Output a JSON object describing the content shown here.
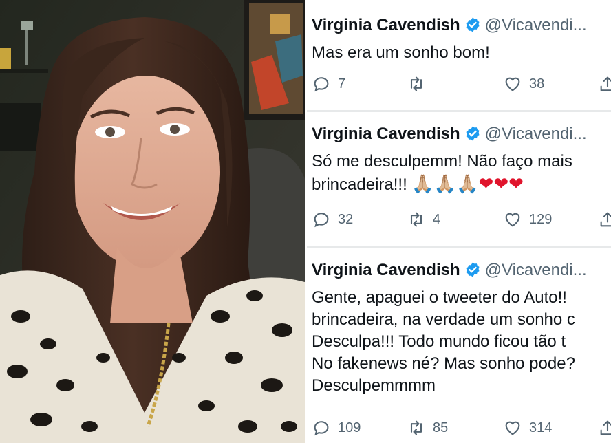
{
  "tweets": [
    {
      "name": "Virginia Cavendish",
      "handle": "@Vicavendi...",
      "lines": [
        "Mas era um sonho bom!"
      ],
      "replies": "7",
      "retweets": "",
      "likes": "38"
    },
    {
      "name": "Virginia Cavendish",
      "handle": "@Vicavendi...",
      "lines": [
        "Só me desculpemm! Não faço mais",
        "brincadeira!!! "
      ],
      "emojis": [
        "🙏🏼",
        "🙏🏼",
        "🙏🏼",
        "❤",
        "❤",
        "❤"
      ],
      "replies": "32",
      "retweets": "4",
      "likes": "129"
    },
    {
      "name": "Virginia Cavendish",
      "handle": "@Vicavendi...",
      "lines": [
        "Gente, apaguei o tweeter do Auto!!",
        "brincadeira, na verdade um sonho c",
        "Desculpa!!! Todo mundo ficou tão t",
        "No fakenews né? Mas sonho pode?",
        "Desculpemmmm"
      ],
      "replies": "109",
      "retweets": "85",
      "likes": "314"
    }
  ],
  "colors": {
    "verified": "#1d9bf0",
    "text": "#0f1419",
    "muted": "#536471"
  },
  "icons": [
    "reply-icon",
    "retweet-icon",
    "like-icon",
    "share-icon",
    "verified-badge-icon"
  ]
}
